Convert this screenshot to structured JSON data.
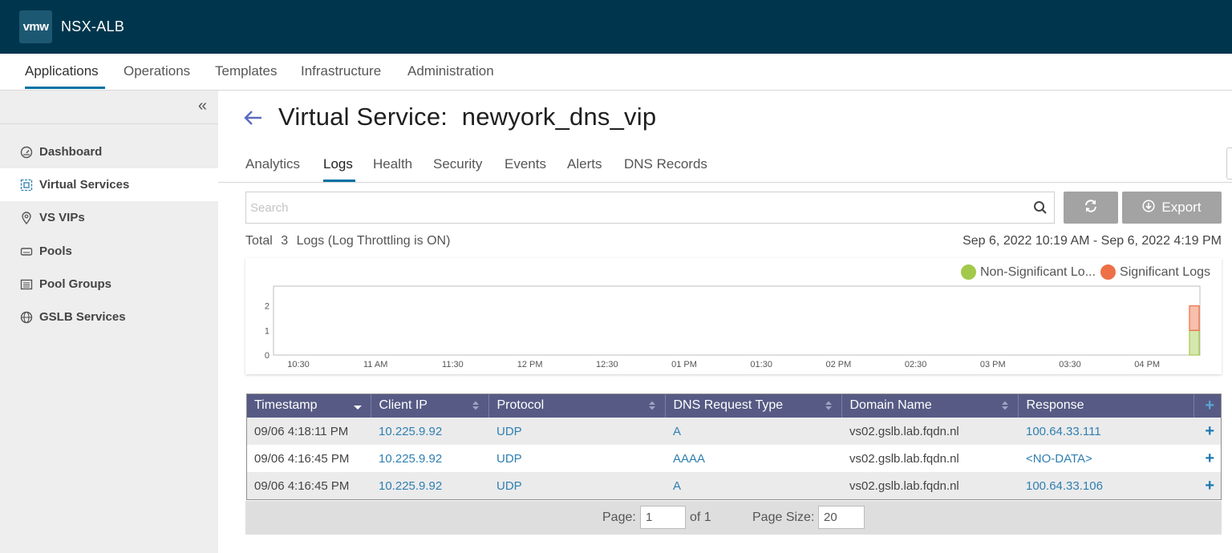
{
  "topbar": {
    "logo": "vmw",
    "product": "NSX-ALB"
  },
  "main_nav": [
    {
      "label": "Applications",
      "active": true
    },
    {
      "label": "Operations"
    },
    {
      "label": "Templates"
    },
    {
      "label": "Infrastructure"
    },
    {
      "label": "Administration"
    }
  ],
  "sidebar": {
    "collapse_icon": "double-chevron-left-icon",
    "items": [
      {
        "label": "Dashboard",
        "icon": "gauge-icon"
      },
      {
        "label": "Virtual Services",
        "icon": "virtual-service-icon",
        "active": true
      },
      {
        "label": "VS VIPs",
        "icon": "map-pin-icon"
      },
      {
        "label": "Pools",
        "icon": "hard-drive-icon"
      },
      {
        "label": "Pool Groups",
        "icon": "list-box-icon"
      },
      {
        "label": "GSLB Services",
        "icon": "globe-icon"
      }
    ]
  },
  "page": {
    "title_prefix": "Virtual Service:",
    "title_name": "newyork_dns_vip",
    "tabs": [
      {
        "label": "Analytics"
      },
      {
        "label": "Logs",
        "active": true
      },
      {
        "label": "Health"
      },
      {
        "label": "Security"
      },
      {
        "label": "Events"
      },
      {
        "label": "Alerts"
      },
      {
        "label": "DNS Records"
      }
    ]
  },
  "search": {
    "placeholder": "Search",
    "export_label": "Export"
  },
  "summary": {
    "total_label": "Total",
    "total_count": "3",
    "logs_label": "Logs (Log Throttling is ON)",
    "date_range": "Sep 6, 2022 10:19 AM - Sep 6, 2022 4:19 PM"
  },
  "legend": [
    {
      "label": "Non-Significant Lo...",
      "color": "#a3c94b"
    },
    {
      "label": "Significant Logs",
      "color": "#ee7046"
    }
  ],
  "chart_data": {
    "type": "bar",
    "x_tick_labels": [
      "10:30",
      "11 AM",
      "11:30",
      "12 PM",
      "12:30",
      "01 PM",
      "01:30",
      "02 PM",
      "02:30",
      "03 PM",
      "03:30",
      "04 PM"
    ],
    "y_ticks": [
      0,
      1,
      2
    ],
    "ylim": [
      0,
      2.8
    ],
    "series": [
      {
        "name": "Non-Significant Lo...",
        "color": "#a3c94b",
        "values": [
          0,
          0,
          0,
          0,
          0,
          0,
          0,
          0,
          0,
          0,
          0,
          0,
          1
        ]
      },
      {
        "name": "Significant Logs",
        "color": "#ee7046",
        "values": [
          0,
          0,
          0,
          0,
          0,
          0,
          0,
          0,
          0,
          0,
          0,
          0,
          1
        ]
      }
    ],
    "stacked": true,
    "grid": false
  },
  "table": {
    "columns": [
      {
        "label": "Timestamp",
        "sort": "desc"
      },
      {
        "label": "Client IP",
        "sort": "both"
      },
      {
        "label": "Protocol",
        "sort": "both"
      },
      {
        "label": "DNS Request Type",
        "sort": "both"
      },
      {
        "label": "Domain Name",
        "sort": "both"
      },
      {
        "label": "Response",
        "sort": "none"
      }
    ],
    "rows": [
      [
        "09/06 4:18:11 PM",
        "10.225.9.92",
        "UDP",
        "A",
        "vs02.gslb.lab.fqdn.nl",
        "100.64.33.111"
      ],
      [
        "09/06 4:16:45 PM",
        "10.225.9.92",
        "UDP",
        "AAAA",
        "vs02.gslb.lab.fqdn.nl",
        "<NO-DATA>"
      ],
      [
        "09/06 4:16:45 PM",
        "10.225.9.92",
        "UDP",
        "A",
        "vs02.gslb.lab.fqdn.nl",
        "100.64.33.106"
      ]
    ],
    "expand_icon": "+"
  },
  "pager": {
    "page_label": "Page:",
    "page_value": "1",
    "of_label": "of 1",
    "size_label": "Page Size:",
    "size_value": "20"
  },
  "colors": {
    "topbar": "#00364d",
    "accent": "#0072a3",
    "table_header": "#565a84",
    "link": "#2f7fb1"
  }
}
